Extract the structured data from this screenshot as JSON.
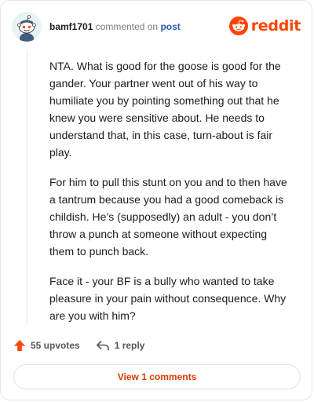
{
  "header": {
    "username": "bamf1701",
    "action_text": "commented on",
    "post_link": "post",
    "brand": "reddit"
  },
  "comment": {
    "paragraphs": [
      "NTA. What is good for the goose is good for the gander. Your partner went out of his way to humiliate you by pointing something out that he knew you were sensitive about. He needs to understand that, in this case, turn-about is fair play.",
      "For him to pull this stunt on you and to then have a tantrum because you had a good comeback is childish. He’s (supposedly) an adult - you don’t throw a punch at someone without expecting them to punch back.",
      "Face it - your BF is a bully who wanted to take pleasure in your pain without consequence. Why are you with him?"
    ]
  },
  "actions": {
    "upvotes": "55 upvotes",
    "replies": "1 reply"
  },
  "footer": {
    "view_comments": "View 1 comments"
  },
  "colors": {
    "brand": "#ff4500",
    "link": "#2a5db0",
    "button_text": "#d93a00"
  },
  "icons": [
    "snoo-avatar-icon",
    "reddit-logo-icon",
    "upvote-arrow-icon",
    "reply-arrow-icon"
  ]
}
